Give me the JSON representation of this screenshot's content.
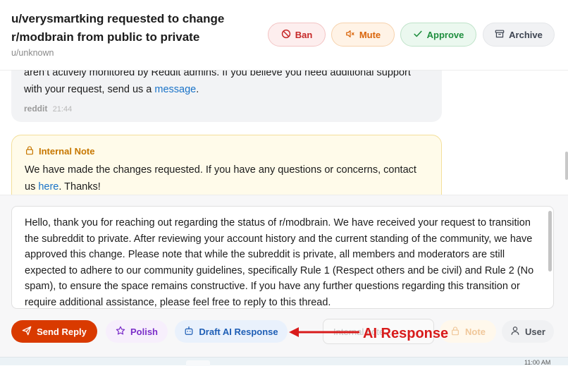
{
  "header": {
    "title": "u/verysmartking requested to change r/modbrain from public to private",
    "subtitle": "u/unknown",
    "buttons": {
      "ban": "Ban",
      "mute": "Mute",
      "approve": "Approve",
      "archive": "Archive"
    }
  },
  "conversation": {
    "message": {
      "line1": "aren’t actively monitored by Reddit admins. If you believe you need additional support",
      "line2_prefix": "with your request, send us a ",
      "link": "message",
      "line2_suffix": ".",
      "author": "reddit",
      "time": "21:44"
    },
    "note": {
      "label": "Internal Note",
      "text_prefix": "We have made the changes requested. If you have any questions or concerns, contact us ",
      "link": "here",
      "text_suffix": ". Thanks!"
    }
  },
  "composer": {
    "reply_text": "Hello, thank you for reaching out regarding the status of r/modbrain. We have received your request to transition the subreddit to private. After reviewing your account history and the current standing of the community, we have approved this change. Please note that while the subreddit is private, all members and moderators are still expected to adhere to our community guidelines, specifically Rule 1 (Respect others and be civil) and Rule 2 (No spam), to ensure the space remains constructive. If you have any further questions regarding this transition or require additional assistance, please feel free to reply to this thread.",
    "buttons": {
      "send": "Send Reply",
      "polish": "Polish",
      "draft": "Draft AI Response",
      "note": "Note",
      "user": "User"
    },
    "internal_placeholder": "Internal note..."
  },
  "annotation": {
    "label": "AI Response"
  },
  "status_bar": {
    "clock": "11:00 AM"
  },
  "colors": {
    "send": "#d93a00",
    "ban": "#c62828",
    "mute": "#d9650b",
    "approve": "#1e8e3e",
    "note_accent": "#c77700",
    "annotation": "#d81b1b",
    "link": "#1a73c8"
  },
  "icons": {
    "ban": "ban-icon",
    "mute": "mute-icon",
    "approve": "check-icon",
    "archive": "archive-icon",
    "note": "lock-icon",
    "send": "send-icon",
    "polish": "star-icon",
    "draft": "robot-icon",
    "user": "user-icon"
  }
}
